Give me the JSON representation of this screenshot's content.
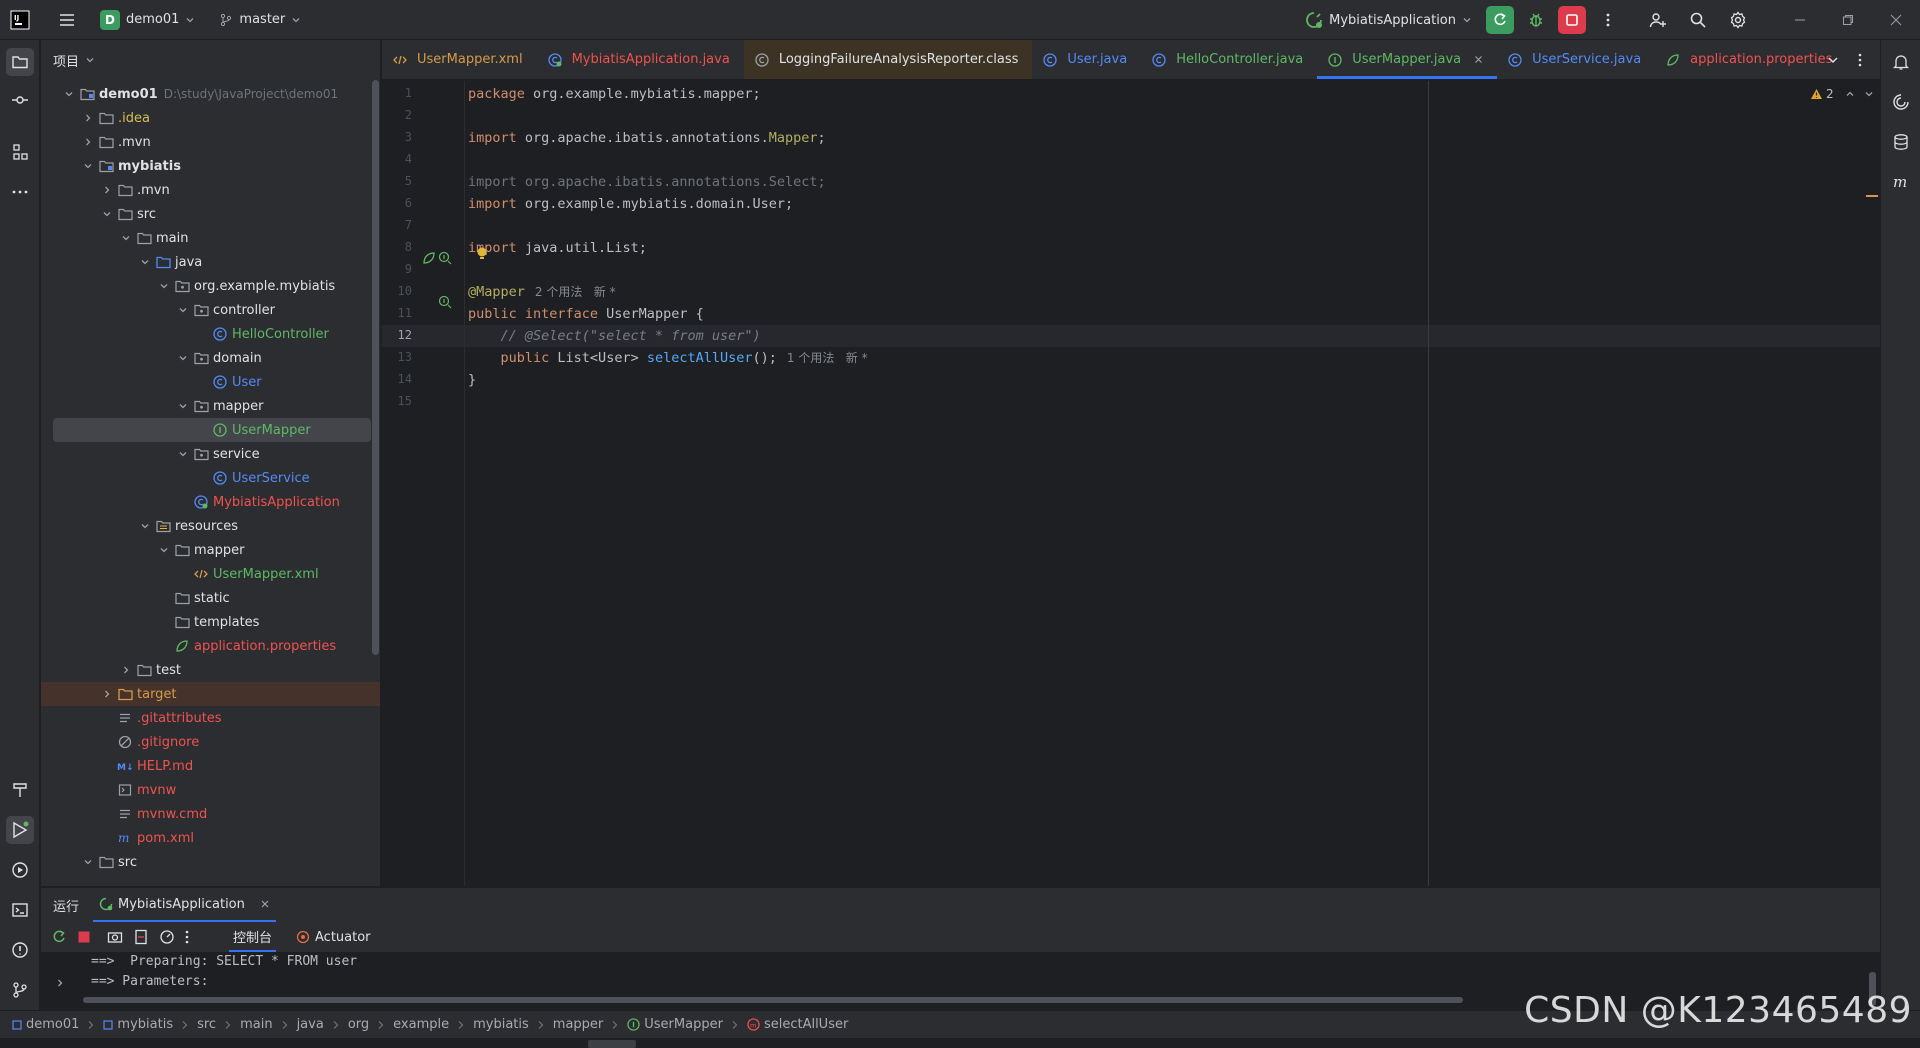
{
  "titlebar": {
    "project_letter": "D",
    "project_name": "demo01",
    "branch": "master",
    "run_config": "MybiatisApplication"
  },
  "project_panel": {
    "title": "项目",
    "root_path": "D:\\study\\JavaProject\\demo01",
    "tree": [
      {
        "label": "demo01",
        "depth": 0,
        "open": true,
        "icon": "module-icon",
        "color": "#dfe1e5",
        "bold": true
      },
      {
        "label": ".idea",
        "depth": 1,
        "open": false,
        "icon": "folder-icon",
        "color": "#d6bf55"
      },
      {
        "label": ".mvn",
        "depth": 1,
        "open": false,
        "icon": "folder-icon",
        "color": "#dfe1e5"
      },
      {
        "label": "mybiatis",
        "depth": 1,
        "open": true,
        "icon": "module-icon",
        "color": "#dfe1e5",
        "bold": true
      },
      {
        "label": ".mvn",
        "depth": 2,
        "open": false,
        "icon": "folder-icon",
        "color": "#dfe1e5"
      },
      {
        "label": "src",
        "depth": 2,
        "open": true,
        "icon": "folder-icon",
        "color": "#dfe1e5"
      },
      {
        "label": "main",
        "depth": 3,
        "open": true,
        "icon": "folder-icon",
        "color": "#dfe1e5"
      },
      {
        "label": "java",
        "depth": 4,
        "open": true,
        "icon": "source-folder-icon",
        "color": "#dfe1e5"
      },
      {
        "label": "org.example.mybiatis",
        "depth": 5,
        "open": true,
        "icon": "package-icon",
        "color": "#dfe1e5"
      },
      {
        "label": "controller",
        "depth": 6,
        "open": true,
        "icon": "package-icon",
        "color": "#dfe1e5"
      },
      {
        "label": "HelloController",
        "depth": 7,
        "open": null,
        "icon": "class-icon",
        "color": "#5fb865"
      },
      {
        "label": "domain",
        "depth": 6,
        "open": true,
        "icon": "package-icon",
        "color": "#dfe1e5"
      },
      {
        "label": "User",
        "depth": 7,
        "open": null,
        "icon": "class-icon",
        "color": "#548af7"
      },
      {
        "label": "mapper",
        "depth": 6,
        "open": true,
        "icon": "package-icon",
        "color": "#dfe1e5"
      },
      {
        "label": "UserMapper",
        "depth": 7,
        "open": null,
        "icon": "interface-icon",
        "color": "#5fb865",
        "selected": true
      },
      {
        "label": "service",
        "depth": 6,
        "open": true,
        "icon": "package-icon",
        "color": "#dfe1e5"
      },
      {
        "label": "UserService",
        "depth": 7,
        "open": null,
        "icon": "class-icon",
        "color": "#548af7"
      },
      {
        "label": "MybiatisApplication",
        "depth": 6,
        "open": null,
        "icon": "spring-class-icon",
        "color": "#f0524f"
      },
      {
        "label": "resources",
        "depth": 4,
        "open": true,
        "icon": "resources-folder-icon",
        "color": "#dfe1e5"
      },
      {
        "label": "mapper",
        "depth": 5,
        "open": true,
        "icon": "folder-icon",
        "color": "#dfe1e5"
      },
      {
        "label": "UserMapper.xml",
        "depth": 6,
        "open": null,
        "icon": "xml-icon",
        "color": "#5fb865"
      },
      {
        "label": "static",
        "depth": 5,
        "open": null,
        "icon": "folder-icon",
        "color": "#dfe1e5"
      },
      {
        "label": "templates",
        "depth": 5,
        "open": null,
        "icon": "folder-icon",
        "color": "#dfe1e5"
      },
      {
        "label": "application.properties",
        "depth": 5,
        "open": null,
        "icon": "spring-props-icon",
        "color": "#f0524f"
      },
      {
        "label": "test",
        "depth": 3,
        "open": false,
        "icon": "folder-icon",
        "color": "#dfe1e5"
      },
      {
        "label": "target",
        "depth": 2,
        "open": false,
        "icon": "excluded-folder-icon",
        "color": "#d59b4a",
        "excluded": true
      },
      {
        "label": ".gitattributes",
        "depth": 2,
        "open": null,
        "icon": "text-file-icon",
        "color": "#f0524f"
      },
      {
        "label": ".gitignore",
        "depth": 2,
        "open": null,
        "icon": "ignore-file-icon",
        "color": "#f0524f"
      },
      {
        "label": "HELP.md",
        "depth": 2,
        "open": null,
        "icon": "markdown-icon",
        "color": "#f0524f"
      },
      {
        "label": "mvnw",
        "depth": 2,
        "open": null,
        "icon": "shell-file-icon",
        "color": "#f0524f"
      },
      {
        "label": "mvnw.cmd",
        "depth": 2,
        "open": null,
        "icon": "text-file-icon",
        "color": "#f0524f"
      },
      {
        "label": "pom.xml",
        "depth": 2,
        "open": null,
        "icon": "maven-icon",
        "color": "#f0524f"
      },
      {
        "label": "src",
        "depth": 1,
        "open": true,
        "icon": "folder-icon",
        "color": "#dfe1e5"
      }
    ]
  },
  "tabs": [
    {
      "label": "UserMapper.xml",
      "icon": "xml-icon",
      "color": "#d59b4a"
    },
    {
      "label": "MybiatisApplication.java",
      "icon": "spring-class-icon",
      "color": "#f0524f"
    },
    {
      "label": "LoggingFailureAnalysisReporter.class",
      "icon": "class-file-icon",
      "color": "#dfe1e5",
      "dark": true
    },
    {
      "label": "User.java",
      "icon": "class-icon",
      "color": "#548af7"
    },
    {
      "label": "HelloController.java",
      "icon": "class-icon",
      "color": "#5fb865"
    },
    {
      "label": "UserMapper.java",
      "icon": "interface-icon",
      "color": "#5fb865",
      "active": true
    },
    {
      "label": "UserService.java",
      "icon": "class-icon",
      "color": "#548af7"
    },
    {
      "label": "application.properties",
      "icon": "spring-props-icon",
      "color": "#f0524f"
    }
  ],
  "editor": {
    "warning_count": "2",
    "current_line": 12,
    "lines": [
      {
        "n": "1",
        "parts": [
          [
            "kw",
            "package "
          ],
          [
            "plain",
            "org.example.mybiatis.mapper;"
          ]
        ]
      },
      {
        "n": "2",
        "parts": []
      },
      {
        "n": "3",
        "parts": [
          [
            "kw",
            "import "
          ],
          [
            "plain",
            "org.apache.ibatis.annotations."
          ],
          [
            "ann",
            "Mapper"
          ],
          [
            "plain",
            ";"
          ]
        ]
      },
      {
        "n": "4",
        "parts": []
      },
      {
        "n": "5",
        "parts": [
          [
            "dim",
            "import org.apache.ibatis.annotations.Select;"
          ]
        ]
      },
      {
        "n": "6",
        "parts": [
          [
            "kw",
            "import "
          ],
          [
            "plain",
            "org.example.mybiatis.domain.User;"
          ]
        ]
      },
      {
        "n": "7",
        "parts": []
      },
      {
        "n": "8",
        "parts": [
          [
            "kw",
            "import "
          ],
          [
            "plain",
            "java.util.List;"
          ]
        ]
      },
      {
        "n": "9",
        "parts": []
      },
      {
        "n": "10",
        "parts": [
          [
            "ann",
            "@Mapper"
          ]
        ],
        "hint": "2 个用法   新 *"
      },
      {
        "n": "11",
        "parts": [
          [
            "kw",
            "public interface "
          ],
          [
            "plain",
            "UserMapper {"
          ]
        ]
      },
      {
        "n": "12",
        "parts": [
          [
            "cmt",
            "    // @Select(\"select * from user\")"
          ]
        ]
      },
      {
        "n": "13",
        "parts": [
          [
            "plain",
            "    "
          ],
          [
            "kw",
            "public "
          ],
          [
            "plain",
            "List<User> "
          ],
          [
            "fn",
            "selectAllUser"
          ],
          [
            "plain",
            "();"
          ]
        ],
        "hint": "1 个用法   新 *"
      },
      {
        "n": "14",
        "parts": [
          [
            "plain",
            "}"
          ]
        ]
      },
      {
        "n": "15",
        "parts": []
      }
    ]
  },
  "run_panel": {
    "title": "运行",
    "config": "MybiatisApplication",
    "console_tab": "控制台",
    "actuator_tab": "Actuator",
    "console_lines": [
      "==>  Preparing: SELECT * FROM user",
      "==> Parameters:"
    ]
  },
  "statusbar": {
    "crumbs": [
      "demo01",
      "mybiatis",
      "src",
      "main",
      "java",
      "org",
      "example",
      "mybiatis",
      "mapper",
      "UserMapper",
      "selectAllUser"
    ]
  },
  "watermark": "CSDN @K123465489"
}
